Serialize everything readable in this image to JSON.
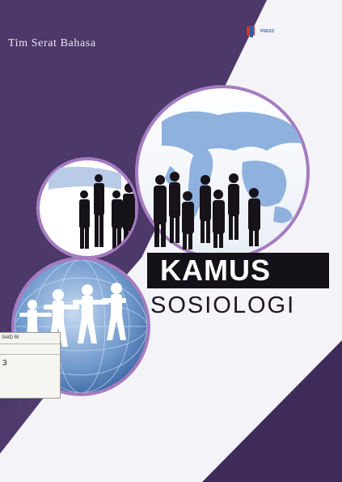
{
  "cover": {
    "author": "Tim Serat Bahasa",
    "title_line1": "KAMUS",
    "title_line2": "SOSIOLOGI",
    "publisher_logo_icon": "publisher-p-logo-icon",
    "publisher_text": "PRESS"
  },
  "library_label": {
    "line1": "SAID RI",
    "line2": "3"
  },
  "colors": {
    "background_purple": "#4f3a6c",
    "circle_border": "#9b6fb5",
    "white_panel": "#f4f3f7",
    "title_band": "#141118",
    "map_blue": "#7ea6d6"
  },
  "icons": [
    "world-map-icon",
    "businesspeople-silhouettes-icon",
    "paper-people-chain-icon",
    "globe-icon"
  ]
}
